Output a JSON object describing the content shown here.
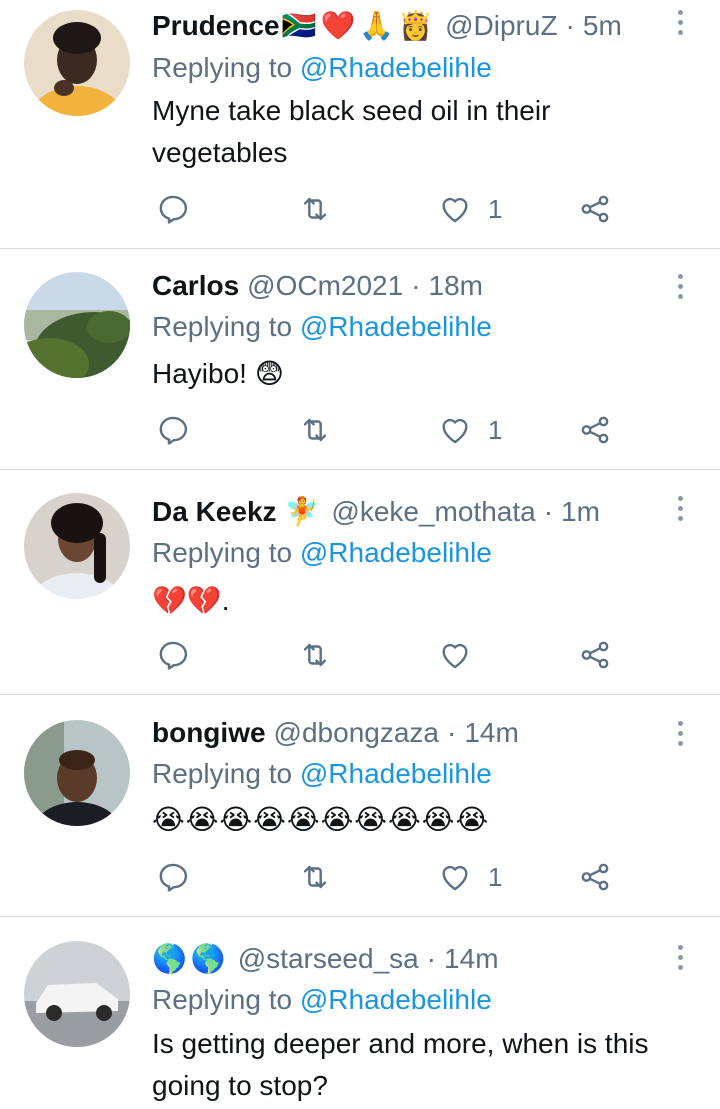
{
  "tweets": [
    {
      "name": "Prudence",
      "name_emoji": [
        "🇿🇦",
        "❤️",
        "🙏",
        "👸"
      ],
      "handle": "@DipruZ",
      "sep": "·",
      "time": "5m",
      "replying_label": "Replying to",
      "replying_to": "@Rhadebelihle",
      "text": "Myne take black seed oil in their vegetables",
      "likes": "1"
    },
    {
      "name": "Carlos",
      "name_emoji": [],
      "handle": "@OCm2021",
      "sep": "·",
      "time": "18m",
      "replying_label": "Replying to",
      "replying_to": "@Rhadebelihle",
      "text": "Hayibo! 😨",
      "likes": "1"
    },
    {
      "name": "Da Keekz",
      "name_emoji": [
        "🧚"
      ],
      "handle": "@keke_mothata",
      "sep": "·",
      "time": "1m",
      "replying_label": "Replying to",
      "replying_to": "@Rhadebelihle",
      "text": "💔💔.",
      "likes": ""
    },
    {
      "name": "bongiwe",
      "name_emoji": [],
      "handle": "@dbongzaza",
      "sep": "·",
      "time": "14m",
      "replying_label": "Replying to",
      "replying_to": "@Rhadebelihle",
      "text": "😭😭😭😭😭😭😭😭😭😭",
      "likes": "1"
    },
    {
      "name": "",
      "name_emoji": [
        "🌎",
        "🌎"
      ],
      "handle": "@starseed_sa",
      "sep": "·",
      "time": "14m",
      "replying_label": "Replying to",
      "replying_to": "@Rhadebelihle",
      "text": "Is getting deeper and more, when is this going to stop?",
      "likes": ""
    }
  ],
  "icons": {
    "reply": "reply-icon",
    "retweet": "retweet-icon",
    "like": "heart-icon",
    "share": "share-icon",
    "more": "more-vertical-icon"
  },
  "colors": {
    "link": "#1b95e0",
    "secondary": "#5b7083",
    "divider": "#dcdcdc"
  }
}
